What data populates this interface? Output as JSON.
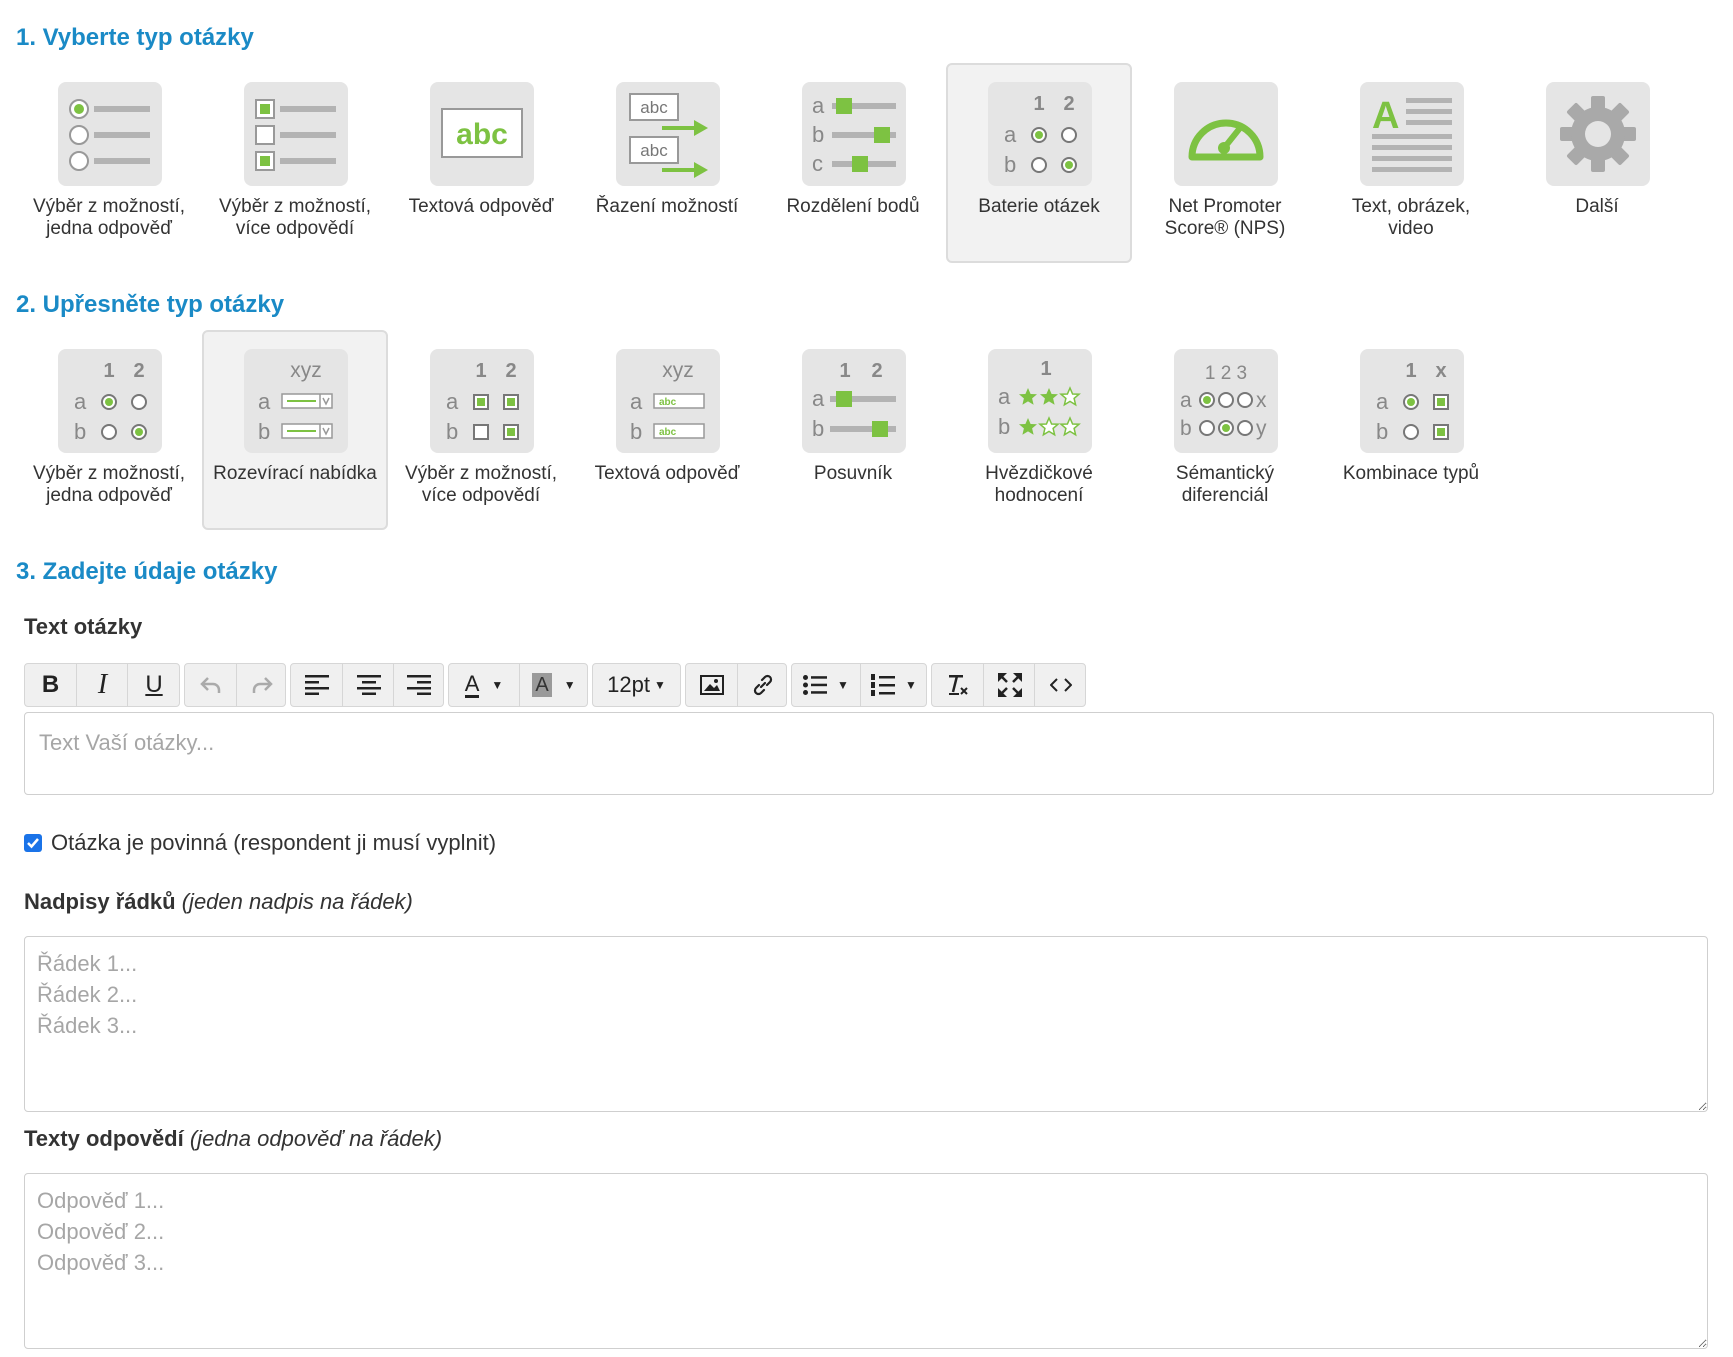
{
  "sections": {
    "step1_title": "1. Vyberte typ otázky",
    "step2_title": "2. Upřesněte typ otázky",
    "step3_title": "3. Zadejte údaje otázky"
  },
  "question_types": [
    {
      "label": "Výběr z možností,\njedna odpověď",
      "icon": "single-choice-icon",
      "selected": false
    },
    {
      "label": "Výběr z možností,\nvíce odpovědí",
      "icon": "multiple-choice-icon",
      "selected": false
    },
    {
      "label": "Textová odpověď",
      "icon": "text-answer-icon",
      "selected": false
    },
    {
      "label": "Řazení možností",
      "icon": "ordering-icon",
      "selected": false
    },
    {
      "label": "Rozdělení bodů",
      "icon": "points-distribution-icon",
      "selected": false
    },
    {
      "label": "Baterie otázek",
      "icon": "question-battery-icon",
      "selected": true
    },
    {
      "label": "Net Promoter\nScore® (NPS)",
      "icon": "nps-gauge-icon",
      "selected": false
    },
    {
      "label": "Text, obrázek,\nvideo",
      "icon": "text-image-video-icon",
      "selected": false
    },
    {
      "label": "Další",
      "icon": "gear-icon",
      "selected": false
    }
  ],
  "subtypes": [
    {
      "label": "Výběr z možností,\njedna odpověď",
      "icon": "battery-single-choice-icon",
      "selected": false
    },
    {
      "label": "Rozevírací nabídka",
      "icon": "battery-dropdown-icon",
      "selected": true
    },
    {
      "label": "Výběr z možností,\nvíce odpovědí",
      "icon": "battery-multiple-choice-icon",
      "selected": false
    },
    {
      "label": "Textová odpověď",
      "icon": "battery-text-icon",
      "selected": false
    },
    {
      "label": "Posuvník",
      "icon": "battery-slider-icon",
      "selected": false
    },
    {
      "label": "Hvězdičkové\nhodnocení",
      "icon": "battery-star-rating-icon",
      "selected": false
    },
    {
      "label": "Sémantický\ndiferenciál",
      "icon": "battery-semantic-differential-icon",
      "selected": false
    },
    {
      "label": "Kombinace typů",
      "icon": "battery-combination-icon",
      "selected": false
    }
  ],
  "icon_text": {
    "cols": [
      "1",
      "2"
    ],
    "rows": [
      "a",
      "b"
    ],
    "abc": "abc",
    "xyz": "xyz",
    "one": "1",
    "x": "x",
    "sd_cols": "1 2 3",
    "sd_left": [
      "a",
      "b"
    ],
    "sd_right": [
      "x",
      "y"
    ],
    "dist_rows": [
      "a",
      "b",
      "c"
    ],
    "big_a": "A"
  },
  "form": {
    "question_text_label": "Text otázky",
    "question_text_placeholder": "Text Vaší otázky...",
    "required_checked": true,
    "required_label": "Otázka je povinná (respondent ji musí vyplnit)",
    "rows_label": "Nadpisy řádků",
    "rows_hint": "(jeden nadpis na řádek)",
    "rows_placeholder": "Řádek 1...\nŘádek 2...\nŘádek 3...",
    "answers_label": "Texty odpovědí",
    "answers_hint": "(jedna odpověď na řádek)",
    "answers_placeholder": "Odpověď 1...\nOdpověď 2...\nOdpověď 3..."
  },
  "toolbar": {
    "bold": "B",
    "italic": "I",
    "underline": "U",
    "font_color": "A",
    "bg_color": "A",
    "font_size": "12pt"
  },
  "colors": {
    "accent": "#1a8ac6",
    "icon_green": "#7dc242",
    "icon_bg": "#e5e5e5",
    "icon_gray": "#b3b3b3",
    "checkbox": "#1a73e8"
  }
}
